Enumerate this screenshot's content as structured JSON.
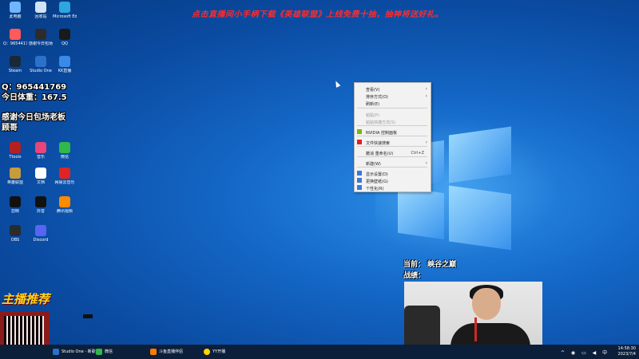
{
  "banner": "点击直播间小手柄下载《英雄联盟》上线免费十抽，抽神将送好礼。",
  "overlay": {
    "qq": "Q：965441769",
    "weight": "今日体重：167.5",
    "thanks": "感谢今日包场老板",
    "thanks_name": "顾哥",
    "brand": "主播推荐",
    "current_label": "当前：",
    "current_value": "峡谷之巅",
    "record_label": "战绩："
  },
  "desktop_icons": [
    {
      "label": "此电脑",
      "color": "#6fb6ff"
    },
    {
      "label": "回收站",
      "color": "#d0e4f5"
    },
    {
      "label": "Microsoft Edge",
      "color": "#2da6e0"
    },
    {
      "label": "Q：965441769",
      "color": "#ff5a5a"
    },
    {
      "label": "感谢今日包场",
      "color": "#2c2c2c"
    },
    {
      "label": "QQ",
      "color": "#1a1a1a"
    },
    {
      "label": "Steam",
      "color": "#1b2838"
    },
    {
      "label": "Studio One",
      "color": "#2b70c9"
    },
    {
      "label": "KK直播",
      "color": "#3a8ae8"
    },
    {
      "label": "Ttools",
      "color": "#b62020"
    },
    {
      "label": "音乐",
      "color": "#e8457a"
    },
    {
      "label": "微信",
      "color": "#2fb94a"
    },
    {
      "label": "英雄联盟",
      "color": "#c89b3c"
    },
    {
      "label": "文档",
      "color": "#ffffff"
    },
    {
      "label": "网易云音乐",
      "color": "#e02424"
    },
    {
      "label": "剪映",
      "color": "#111111"
    },
    {
      "label": "抖音",
      "color": "#111111"
    },
    {
      "label": "腾讯视频",
      "color": "#ff8a00"
    },
    {
      "label": "OBS",
      "color": "#2b2b2b"
    },
    {
      "label": "Discord",
      "color": "#5865f2"
    }
  ],
  "context_menu": {
    "items": [
      {
        "label": "查看(V)",
        "submenu": true,
        "disabled": false,
        "icon": ""
      },
      {
        "label": "排序方式(O)",
        "submenu": true,
        "disabled": false,
        "icon": ""
      },
      {
        "label": "刷新(E)",
        "submenu": false,
        "disabled": false,
        "icon": ""
      },
      {
        "label": "粘贴(P)",
        "submenu": false,
        "disabled": true,
        "icon": ""
      },
      {
        "label": "粘贴快捷方式(S)",
        "submenu": false,
        "disabled": true,
        "icon": ""
      },
      {
        "label": "NVIDIA 控制面板",
        "submenu": false,
        "disabled": false,
        "icon": "nvidia-icon"
      },
      {
        "label": "文件快速搜索",
        "submenu": true,
        "disabled": false,
        "icon": "wps-icon"
      },
      {
        "label": "撤消 重命名(U)",
        "submenu": false,
        "disabled": false,
        "icon": "",
        "shortcut": "Ctrl+Z"
      },
      {
        "label": "新建(W)",
        "submenu": true,
        "disabled": false,
        "icon": ""
      },
      {
        "label": "显示设置(D)",
        "submenu": false,
        "disabled": false,
        "icon": "display-icon"
      },
      {
        "label": "更换壁纸(G)",
        "submenu": false,
        "disabled": false,
        "icon": "wallpaper-icon"
      },
      {
        "label": "个性化(R)",
        "submenu": false,
        "disabled": false,
        "icon": "personalize-icon"
      }
    ]
  },
  "taskbar": {
    "items": [
      {
        "label": "Studio One - 新歌...",
        "color": "#2b70c9"
      },
      {
        "label": "微信",
        "color": "#2fb94a"
      },
      {
        "label": "斗鱼直播伴侣",
        "color": "#ff7a00"
      },
      {
        "label": "YY开播",
        "color": "#ffd400"
      }
    ],
    "time": "14:58:30",
    "date": "2023/7/4"
  },
  "colors": {
    "accent": "#1467c6",
    "banner": "#ff2b2b",
    "menu_bg": "#f2f2f2"
  }
}
